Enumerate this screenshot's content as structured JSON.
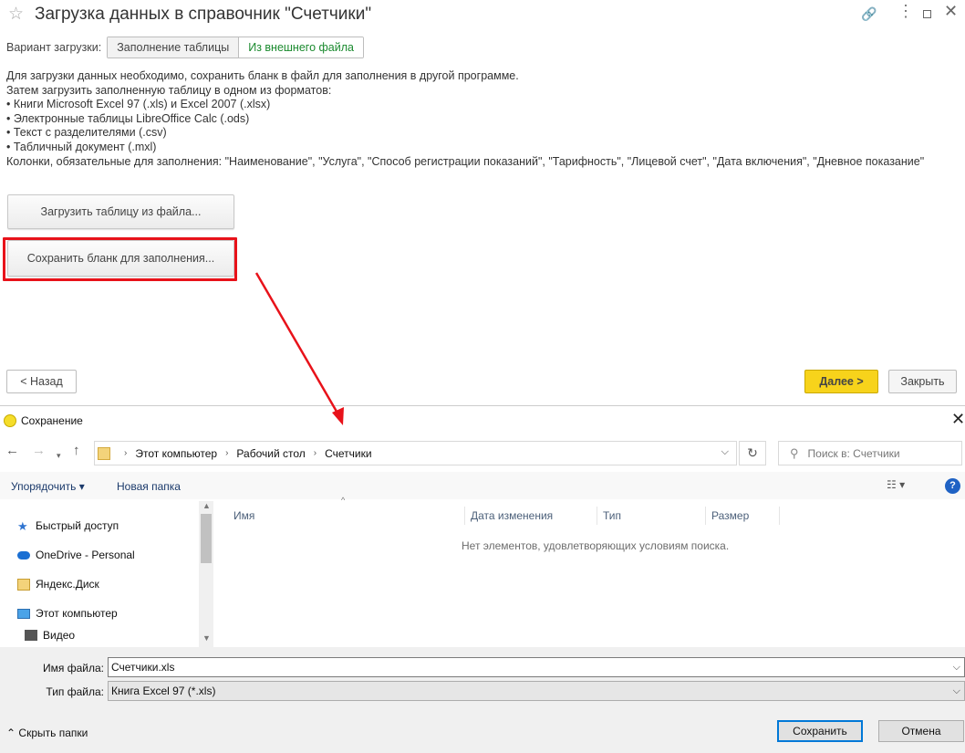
{
  "form": {
    "title": "Загрузка данных в справочник \"Счетчики\"",
    "variant_label": "Вариант загрузки:",
    "variant_options": [
      "Заполнение таблицы",
      "Из внешнего файла"
    ],
    "variant_selected": "Из внешнего файла",
    "description": [
      "Для загрузки данных необходимо, сохранить бланк в файл для заполнения в другой программе.",
      "Затем загрузить заполненную таблицу в одном из форматов:",
      "• Книги Microsoft Excel 97 (.xls) и Excel 2007 (.xlsx)",
      "• Электронные таблицы LibreOffice Calc (.ods)",
      "• Текст с разделителями (.csv)",
      "• Табличный документ (.mxl)",
      "Колонки, обязательные для заполнения: \"Наименование\", \"Услуга\", \"Способ регистрации показаний\", \"Тарифность\", \"Лицевой счет\", \"Дата включения\", \"Дневное показание\""
    ],
    "load_button": "Загрузить таблицу из файла...",
    "save_button": "Сохранить бланк для заполнения...",
    "back_button": "< Назад",
    "next_button": "Далее >",
    "close_button": "Закрыть",
    "highlight_color": "#e8121a",
    "accent_color": "#f7d31b"
  },
  "dialog": {
    "title": "Сохранение",
    "breadcrumb": [
      "Этот компьютер",
      "Рабочий стол",
      "Счетчики"
    ],
    "search_placeholder": "Поиск в: Счетчики",
    "toolbar": {
      "organize": "Упорядочить ▾",
      "new_folder": "Новая папка",
      "view": "☷ ▾",
      "help": "?"
    },
    "nav_tree": [
      "Быстрый доступ",
      "OneDrive - Personal",
      "Яндекс.Диск",
      "Этот компьютер",
      "Видео"
    ],
    "columns": [
      "Имя",
      "Дата изменения",
      "Тип",
      "Размер"
    ],
    "empty_message": "Нет элементов, удовлетворяющих условиям поиска.",
    "filename_label": "Имя файла:",
    "filename_value": "Счетчики.xls",
    "filetype_label": "Тип файла:",
    "filetype_value": "Книга Excel 97 (*.xls)",
    "hide_folders": "Скрыть папки",
    "save_button": "Сохранить",
    "cancel_button": "Отмена"
  }
}
